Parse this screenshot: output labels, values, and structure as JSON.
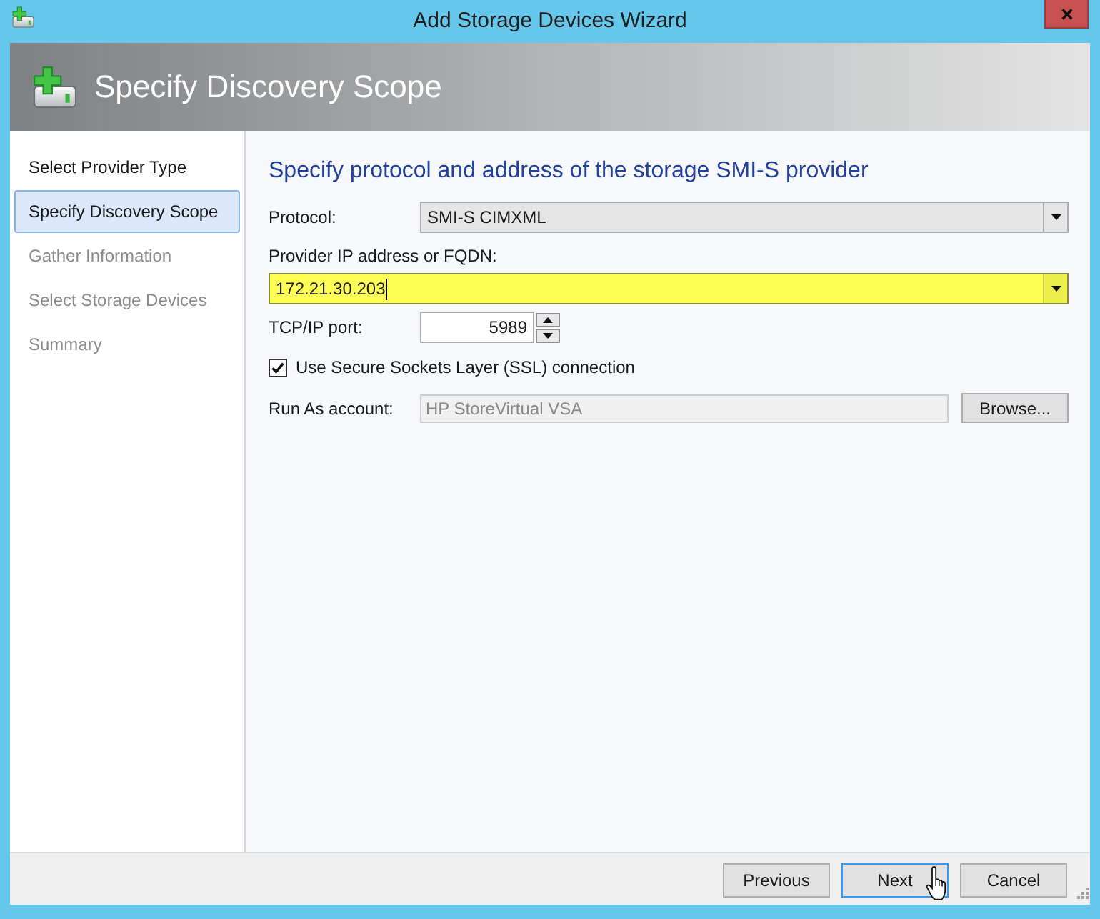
{
  "window": {
    "title": "Add Storage Devices Wizard"
  },
  "header": {
    "title": "Specify Discovery Scope"
  },
  "steps": [
    {
      "label": "Select Provider Type",
      "selected": false,
      "disabled": false
    },
    {
      "label": "Specify Discovery Scope",
      "selected": true,
      "disabled": false
    },
    {
      "label": "Gather Information",
      "selected": false,
      "disabled": true
    },
    {
      "label": "Select Storage Devices",
      "selected": false,
      "disabled": true
    },
    {
      "label": "Summary",
      "selected": false,
      "disabled": true
    }
  ],
  "form": {
    "heading": "Specify protocol and address of the storage SMI-S provider",
    "fields": [
      {
        "kind": "dropdown",
        "label": "Protocol:",
        "value": "SMI-S CIMXML"
      },
      {
        "kind": "combo",
        "label": "Provider IP address or FQDN:",
        "value": "172.21.30.203",
        "highlighted": true
      },
      {
        "kind": "spinner",
        "label": "TCP/IP port:",
        "value": "5989"
      },
      {
        "kind": "checkbox",
        "label": "Use Secure Sockets Layer (SSL) connection",
        "checked": true
      },
      {
        "kind": "account",
        "label": "Run As account:",
        "value": "HP StoreVirtual VSA",
        "disabled": true,
        "button": "Browse..."
      }
    ]
  },
  "buttons": [
    {
      "label": "Previous",
      "focused": false
    },
    {
      "label": "Next",
      "focused": true
    },
    {
      "label": "Cancel",
      "focused": false
    }
  ]
}
